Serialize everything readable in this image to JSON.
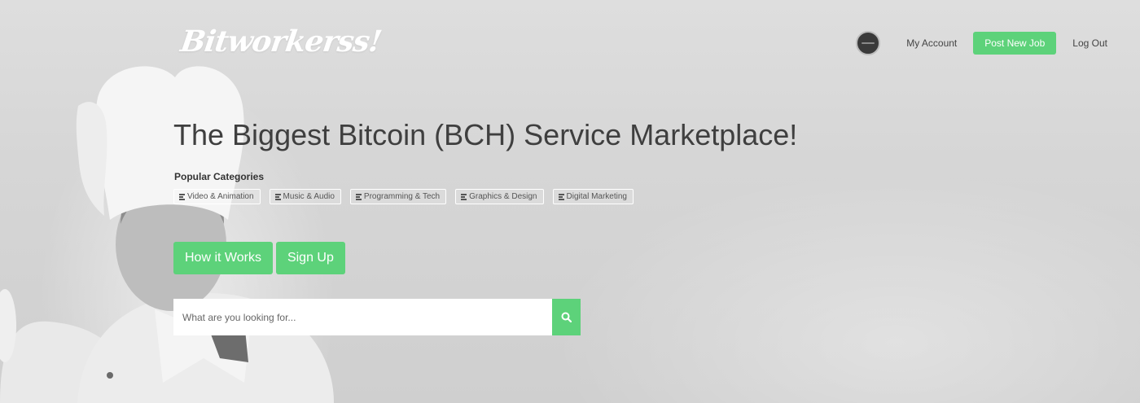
{
  "brand": {
    "logo_text": "Bitworkerss!"
  },
  "nav": {
    "avatar_icon": "user-avatar-icon",
    "my_account": "My Account",
    "post_new_job": "Post New Job",
    "log_out": "Log Out"
  },
  "hero": {
    "headline": "The Biggest Bitcoin (BCH) Service Marketplace!",
    "popular_label": "Popular Categories",
    "categories": [
      {
        "label": "Video & Animation",
        "icon": "list-icon"
      },
      {
        "label": "Music & Audio",
        "icon": "list-icon"
      },
      {
        "label": "Programming & Tech",
        "icon": "list-icon"
      },
      {
        "label": "Graphics & Design",
        "icon": "list-icon"
      },
      {
        "label": "Digital Marketing",
        "icon": "list-icon"
      }
    ],
    "how_it_works": "How it Works",
    "sign_up": "Sign Up"
  },
  "search": {
    "placeholder": "What are you looking for...",
    "value": "",
    "button_icon": "search-icon"
  },
  "colors": {
    "accent": "#5dd27a",
    "text_dark": "#3f3f3f",
    "background": "#d9d9d9"
  }
}
